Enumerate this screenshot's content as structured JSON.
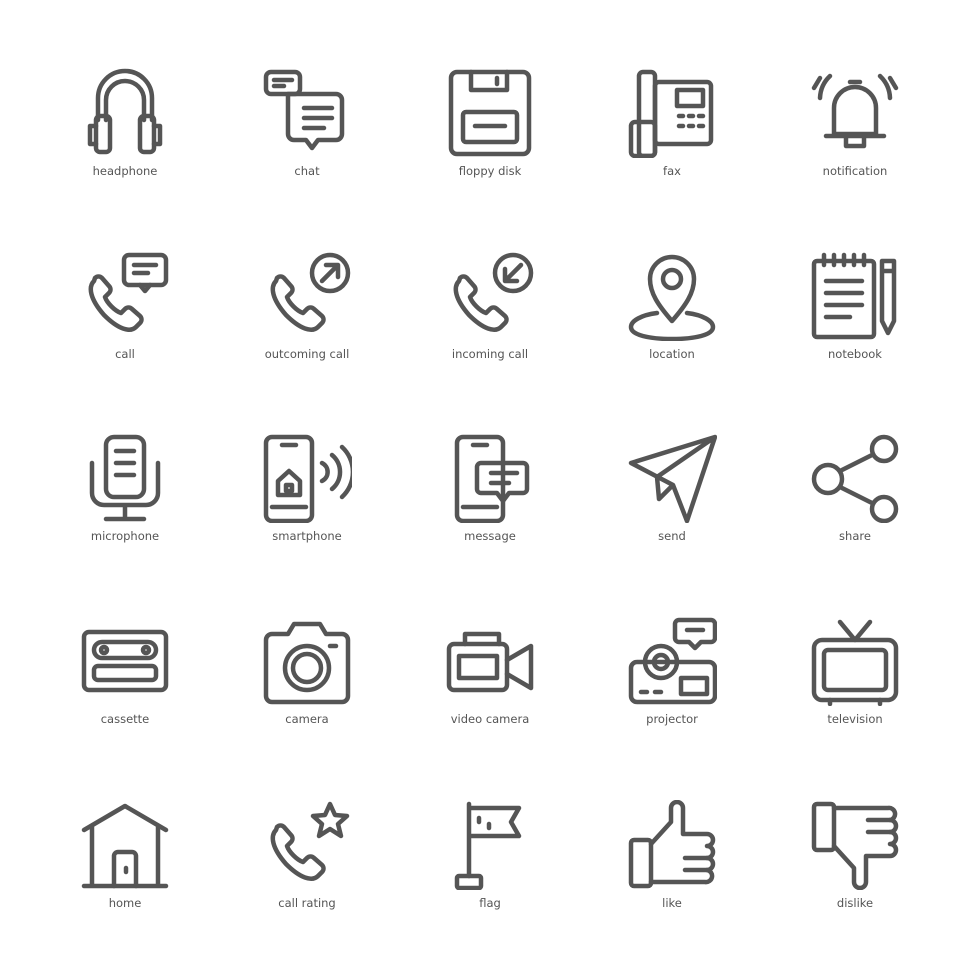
{
  "colors": {
    "stroke": "#555555",
    "background": "#ffffff"
  },
  "icons": [
    {
      "label": "headphone",
      "icon": "headphone-icon"
    },
    {
      "label": "chat",
      "icon": "chat-icon"
    },
    {
      "label": "floppy disk",
      "icon": "floppy-disk-icon"
    },
    {
      "label": "fax",
      "icon": "fax-icon"
    },
    {
      "label": "notification",
      "icon": "notification-icon"
    },
    {
      "label": "call",
      "icon": "call-icon"
    },
    {
      "label": "outcoming call",
      "icon": "outcoming-call-icon"
    },
    {
      "label": "incoming call",
      "icon": "incoming-call-icon"
    },
    {
      "label": "location",
      "icon": "location-icon"
    },
    {
      "label": "notebook",
      "icon": "notebook-icon"
    },
    {
      "label": "microphone",
      "icon": "microphone-icon"
    },
    {
      "label": "smartphone",
      "icon": "smartphone-icon"
    },
    {
      "label": "message",
      "icon": "message-icon"
    },
    {
      "label": "send",
      "icon": "send-icon"
    },
    {
      "label": "share",
      "icon": "share-icon"
    },
    {
      "label": "cassette",
      "icon": "cassette-icon"
    },
    {
      "label": "camera",
      "icon": "camera-icon"
    },
    {
      "label": "video camera",
      "icon": "video-camera-icon"
    },
    {
      "label": "projector",
      "icon": "projector-icon"
    },
    {
      "label": "television",
      "icon": "television-icon"
    },
    {
      "label": "home",
      "icon": "home-icon"
    },
    {
      "label": "call rating",
      "icon": "call-rating-icon"
    },
    {
      "label": "flag",
      "icon": "flag-icon"
    },
    {
      "label": "like",
      "icon": "like-icon"
    },
    {
      "label": "dislike",
      "icon": "dislike-icon"
    }
  ]
}
